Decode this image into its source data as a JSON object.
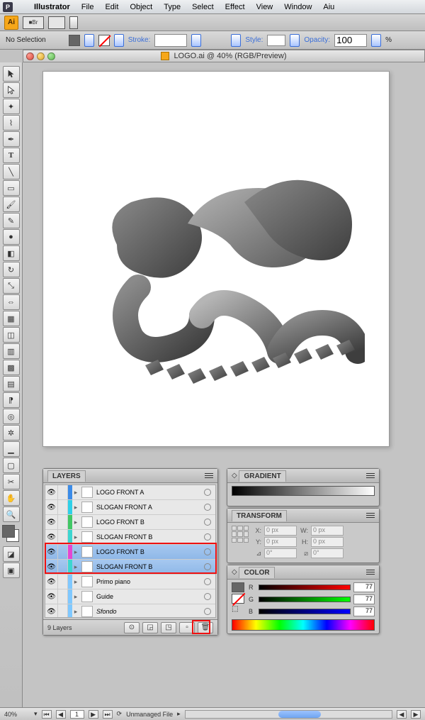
{
  "menubar": {
    "items": [
      "Illustrator",
      "File",
      "Edit",
      "Object",
      "Type",
      "Select",
      "Effect",
      "View",
      "Window",
      "Aiu"
    ]
  },
  "optbar": {
    "ai": "Ai",
    "br": "■Br"
  },
  "ctrl": {
    "no_selection": "No Selection",
    "stroke_label": "Stroke:",
    "style_label": "Style:",
    "opacity_label": "Opacity:",
    "opacity_value": "100",
    "opacity_unit": "%"
  },
  "doc": {
    "title": "LOGO.ai @ 40% (RGB/Preview)"
  },
  "tools": [
    "selection",
    "direct-select",
    "magic-wand",
    "lasso",
    "pen",
    "type",
    "line",
    "rectangle",
    "paintbrush",
    "pencil",
    "blob-brush",
    "eraser",
    "rotate",
    "scale",
    "width",
    "free-transform",
    "shape-builder",
    "perspective",
    "mesh",
    "gradient",
    "eyedropper",
    "blend",
    "symbol-sprayer",
    "graph",
    "artboard",
    "slice",
    "hand",
    "zoom"
  ],
  "layers": {
    "title": "LAYERS",
    "rows": [
      {
        "name": "LOGO FRONT A",
        "sel": false,
        "color": "cs-blue",
        "thumb": "art",
        "eye": true
      },
      {
        "name": "SLOGAN FRONT A",
        "sel": false,
        "color": "cs-cyan",
        "thumb": "empty",
        "eye": true
      },
      {
        "name": "LOGO FRONT B",
        "sel": false,
        "color": "cs-green",
        "thumb": "art",
        "eye": true
      },
      {
        "name": "SLOGAN FRONT B",
        "sel": false,
        "color": "cs-cyan2",
        "thumb": "empty",
        "eye": true
      },
      {
        "name": "LOGO FRONT B",
        "sel": true,
        "color": "cs-magenta",
        "thumb": "empty",
        "eye": true
      },
      {
        "name": "SLOGAN FRONT B",
        "sel": true,
        "color": "cs-cyan2",
        "thumb": "empty",
        "eye": true
      },
      {
        "name": "Primo piano",
        "sel": false,
        "color": "cs-ltblue",
        "thumb": "empty",
        "eye": true
      },
      {
        "name": "Guide",
        "sel": false,
        "color": "cs-ltblue",
        "thumb": "empty",
        "eye": true
      },
      {
        "name": "Sfondo",
        "sel": false,
        "color": "cs-ltblue",
        "thumb": "empty",
        "eye": true,
        "italic": true
      }
    ],
    "footer": "9 Layers"
  },
  "gradient": {
    "title": "GRADIENT"
  },
  "transform": {
    "title": "TRANSFORM",
    "x_label": "X:",
    "x_val": "0 px",
    "y_label": "Y:",
    "y_val": "0 px",
    "w_label": "W:",
    "w_val": "0 px",
    "h_label": "H:",
    "h_val": "0 px",
    "angle": "0°",
    "shear": "0°"
  },
  "color": {
    "title": "COLOR",
    "r_label": "R",
    "r_val": "77",
    "g_label": "G",
    "g_val": "77",
    "b_label": "B",
    "b_val": "77"
  },
  "status": {
    "zoom": "40%",
    "page": "1",
    "doc_status": "Unmanaged File"
  }
}
